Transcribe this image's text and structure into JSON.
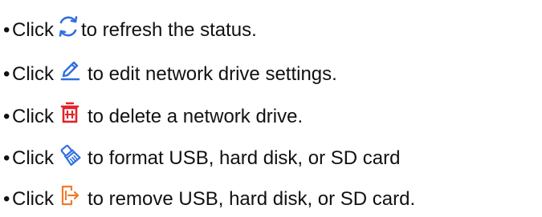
{
  "instructions": [
    {
      "bullet": "•",
      "lead": "Click",
      "icon": "refresh-icon",
      "text": "to refresh the status."
    },
    {
      "bullet": "•",
      "lead": "Click",
      "icon": "edit-pencil-icon",
      "text": "to edit network drive settings."
    },
    {
      "bullet": "•",
      "lead": "Click",
      "icon": "delete-trash-icon",
      "text": "to delete a network drive."
    },
    {
      "bullet": "•",
      "lead": "Click",
      "icon": "format-brush-icon",
      "text": "to format USB, hard disk, or SD card"
    },
    {
      "bullet": "•",
      "lead": "Click",
      "icon": "remove-eject-icon",
      "text": "to remove USB, hard disk, or SD card."
    }
  ],
  "colors": {
    "text": "#111111",
    "icon_blue": "#2f6fde",
    "icon_red": "#e0242b",
    "icon_orange": "#f07a2a"
  }
}
